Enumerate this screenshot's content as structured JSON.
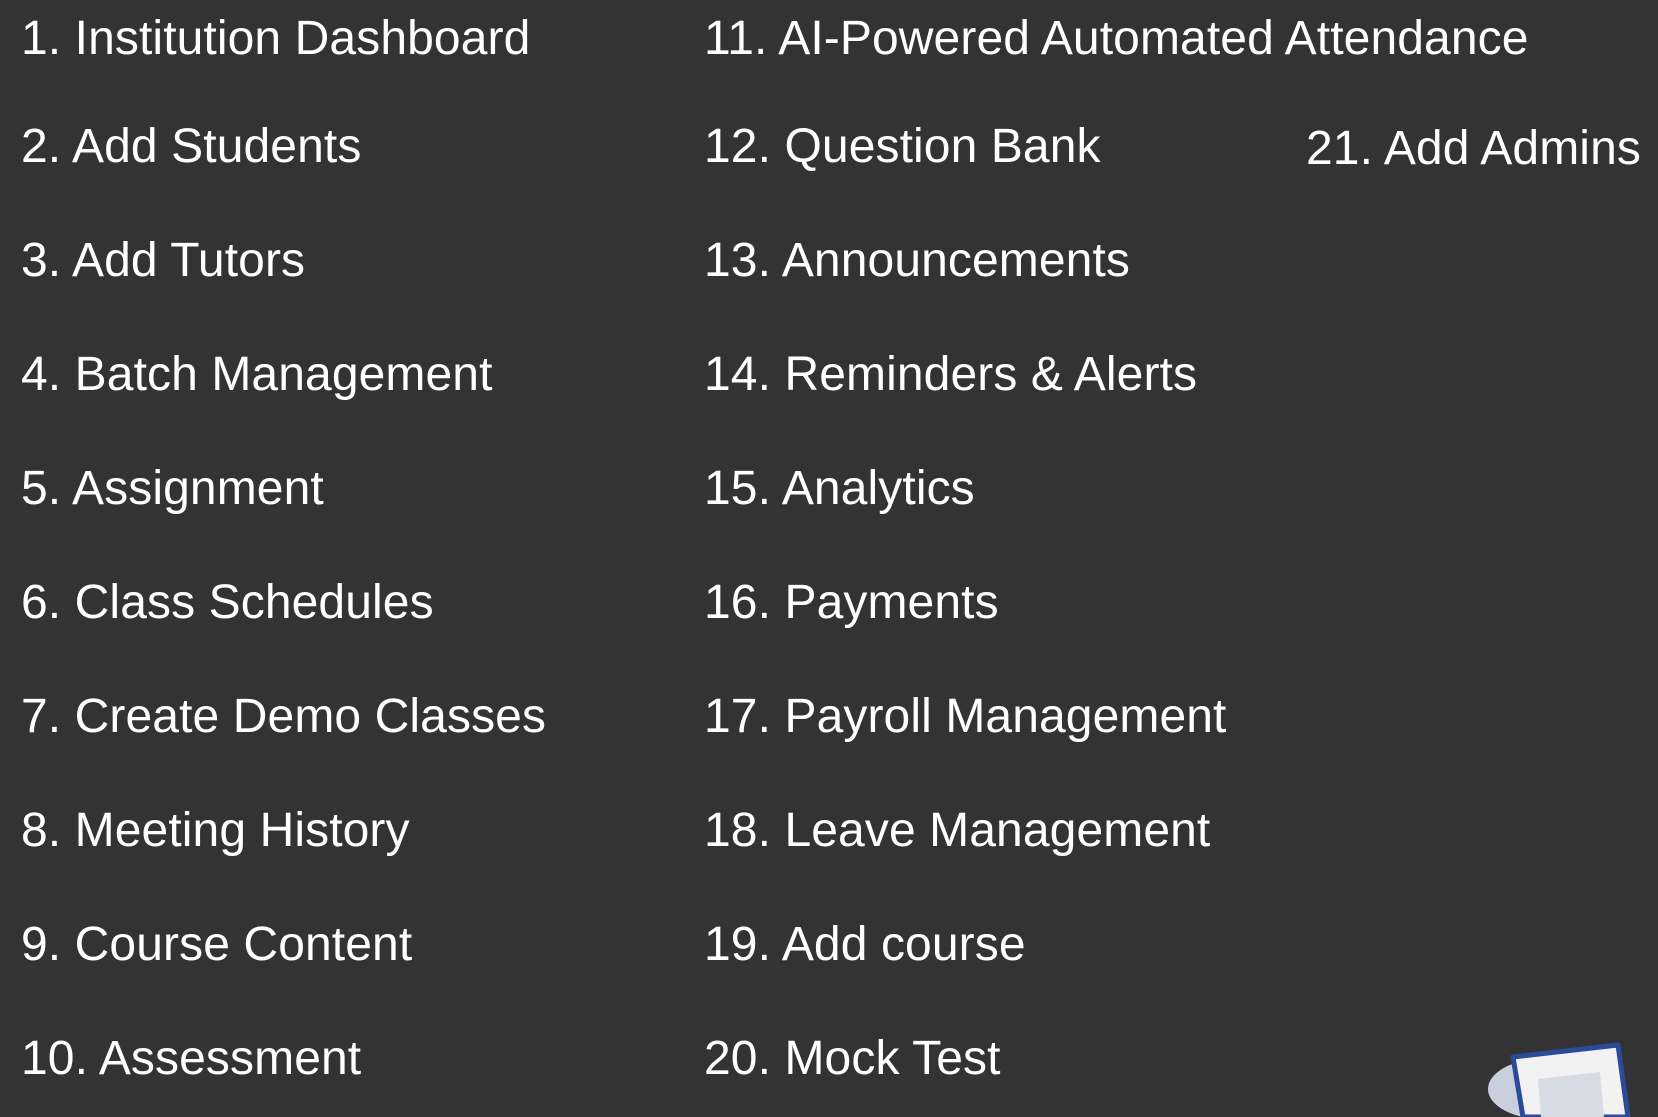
{
  "columns": [
    {
      "items": [
        "1. Institution Dashboard",
        "2. Add Students",
        "3. Add Tutors",
        "4. Batch Management",
        "5. Assignment",
        "6. Class Schedules",
        "7. Create Demo Classes",
        "8. Meeting History",
        "9. Course Content",
        "10. Assessment"
      ]
    },
    {
      "items": [
        "11. AI-Powered Automated Attendance",
        "12. Question Bank",
        "13. Announcements",
        "14. Reminders & Alerts",
        "15. Analytics",
        "16. Payments",
        "17. Payroll Management",
        "18. Leave Management",
        "19. Add course",
        "20. Mock Test"
      ]
    },
    {
      "items": [
        "21. Add Admins"
      ]
    }
  ],
  "colors": {
    "background": "#333333",
    "text": "#ffffff",
    "graphic_outline": "#2a4a9a",
    "graphic_fill": "#f2f2f2",
    "graphic_shadow": "#c9cfdc"
  },
  "icons": {
    "corner_graphic": "document-illustration-icon"
  }
}
